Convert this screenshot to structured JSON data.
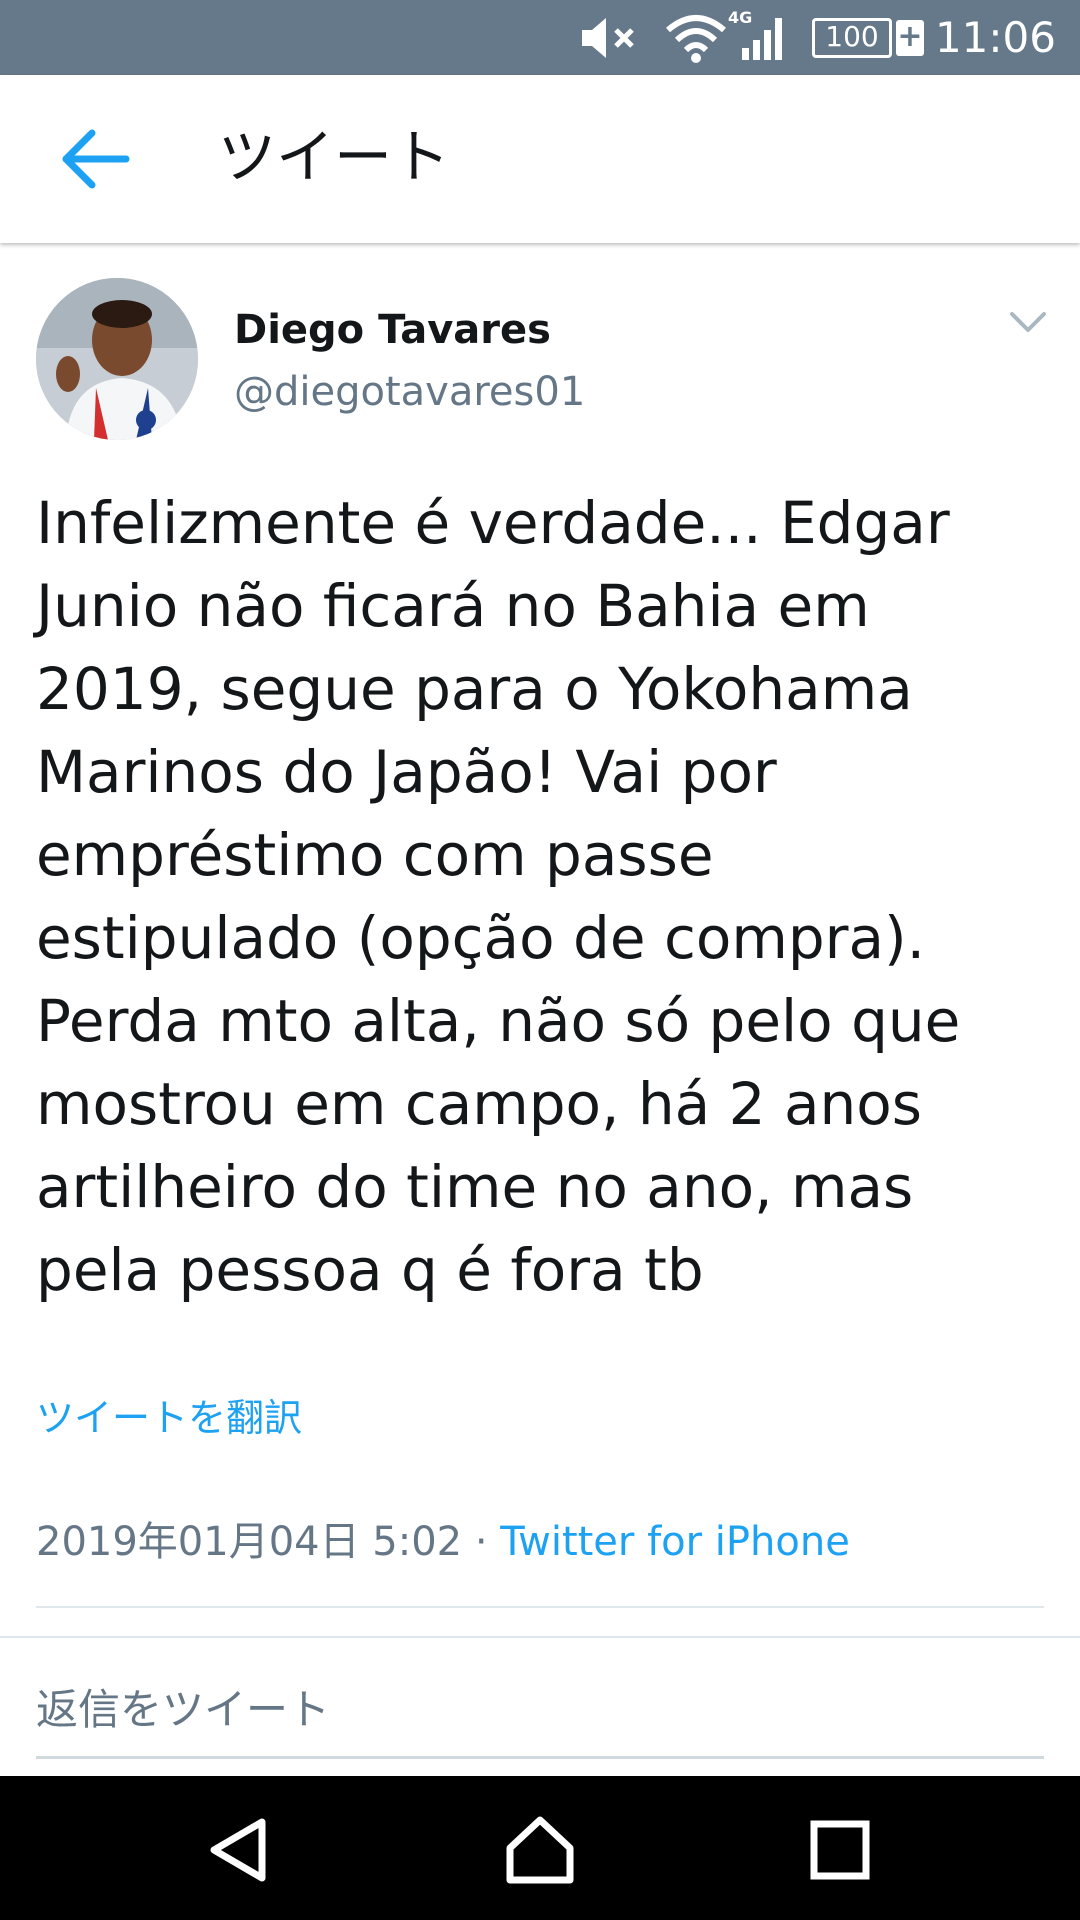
{
  "status_bar": {
    "time": "11:06",
    "battery": "100",
    "network": "4G",
    "icons": [
      "mute-icon",
      "wifi-icon",
      "signal-icon",
      "battery-icon"
    ]
  },
  "header": {
    "title": "ツイート",
    "back_icon": "arrow-left-icon"
  },
  "tweet": {
    "author_name": "Diego Tavares",
    "author_handle": "@diegotavares01",
    "text_lines": [
      "Infelizmente é verdade... Edgar",
      "Junio não ficará no Bahia em",
      "2019, segue para o Yokohama",
      "Marinos do Japão! Vai por",
      "empréstimo com passe",
      "estipulado (opção de compra).",
      "Perda mto alta, não só pelo que",
      "mostrou em campo, há 2 anos",
      "artilheiro do time no ano, mas",
      "pela pessoa q é fora tb"
    ],
    "translate_label": "ツイートを翻訳",
    "timestamp": "2019年01月04日 5:02",
    "separator": " · ",
    "source": "Twitter for iPhone"
  },
  "reply": {
    "placeholder": "返信をツイート"
  },
  "nav_bar": {
    "buttons": [
      "back-triangle-icon",
      "home-icon",
      "recents-icon"
    ]
  },
  "colors": {
    "status_bar": "#66798a",
    "accent": "#1da1f2",
    "secondary_text": "#657786",
    "primary_text": "#14171a"
  }
}
